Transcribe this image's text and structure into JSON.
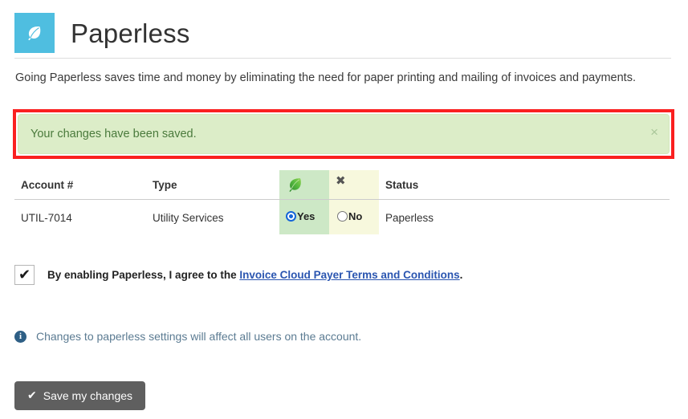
{
  "header": {
    "logo_icon": "leaf-icon",
    "logo_bg": "#4fbee0",
    "title": "Paperless"
  },
  "intro": {
    "text": "Going Paperless saves time and money by eliminating the need for paper printing and mailing of invoices and payments."
  },
  "alert": {
    "message": "Your changes have been saved.",
    "close_label": "×",
    "bg_color": "#dcedc8",
    "text_color": "#4a7a3c",
    "annotation_color": "#fa2020"
  },
  "table": {
    "headers": {
      "account": "Account #",
      "type": "Type",
      "yes_icon": "leaf-icon",
      "no_icon": "cross-icon",
      "status": "Status"
    },
    "rows": [
      {
        "account": "UTIL-7014",
        "type": "Utility Services",
        "yes_label": "Yes",
        "no_label": "No",
        "selected": "Yes",
        "status": "Paperless"
      }
    ],
    "yes_column_color": "#cde8c6",
    "no_column_color": "#f7f8dd"
  },
  "terms": {
    "checked": true,
    "check_glyph": "✔",
    "text_before": "By enabling Paperless, I agree to the ",
    "link_text": "Invoice Cloud Payer Terms and Conditions",
    "text_after": ".",
    "link_color": "#2a55b0"
  },
  "info": {
    "icon": "info-circle-icon",
    "glyph": "i",
    "text": "Changes to paperless settings will affect all users on the account.",
    "color": "#5b7b92"
  },
  "save": {
    "tick_glyph": "✔",
    "label": "Save my changes",
    "bg_color": "#5f5f5f"
  }
}
